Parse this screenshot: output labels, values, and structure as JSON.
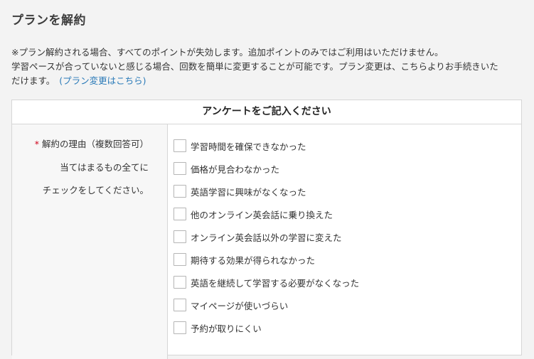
{
  "page": {
    "title": "プランを解約"
  },
  "notice": {
    "line1": "※プラン解約される場合、すべてのポイントが失効します。追加ポイントのみではご利用はいただけません。",
    "line2": "学習ペースが合っていないと感じる場合、回数を簡単に変更することが可能です。プラン変更は、こちらよりお手続きいた",
    "line3": "だけます。",
    "link_text": "(プラン変更はこちら)",
    "link_color": "#2a7ab8"
  },
  "survey": {
    "title": "アンケートをご記入ください",
    "question": {
      "required_mark": "*",
      "label_line1": "解約の理由（複数回答可）",
      "label_line2": "当てはまるもの全てに",
      "label_line3": "チェックをしてください。"
    },
    "options": [
      {
        "label": "学習時間を確保できなかった",
        "checked": false
      },
      {
        "label": "価格が見合わなかった",
        "checked": false
      },
      {
        "label": "英語学習に興味がなくなった",
        "checked": false
      },
      {
        "label": "他のオンライン英会話に乗り換えた",
        "checked": false
      },
      {
        "label": "オンライン英会話以外の学習に変えた",
        "checked": false
      },
      {
        "label": "期待する効果が得られなかった",
        "checked": false
      },
      {
        "label": "英語を継続して学習する必要がなくなった",
        "checked": false
      },
      {
        "label": "マイページが使いづらい",
        "checked": false
      },
      {
        "label": "予約が取りにくい",
        "checked": false
      }
    ]
  },
  "colors": {
    "required": "#d0021b",
    "background": "#f3f3f3"
  }
}
